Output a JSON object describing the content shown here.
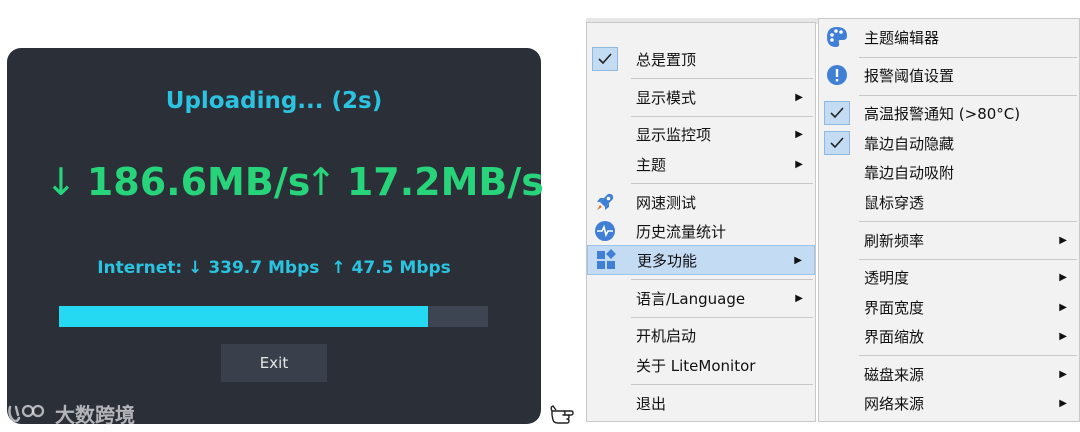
{
  "speed_test": {
    "status": "Uploading... (2s)",
    "download_arrow": "↓",
    "download_speed": "186.6MB/s",
    "upload_arrow": "↑",
    "upload_speed": "17.2MB/s",
    "internet_label": "Internet:",
    "internet_down": "↓ 339.7 Mbps",
    "internet_up": "↑ 47.5 Mbps",
    "progress_fraction": 0.86,
    "exit_label": "Exit"
  },
  "watermark": {
    "text": "大数跨境"
  },
  "main_menu": {
    "items": [
      {
        "label": "总是置顶",
        "checked": true
      },
      {
        "label": "显示模式",
        "submenu": true
      },
      {
        "label": "显示监控项",
        "submenu": true
      },
      {
        "label": "主题",
        "submenu": true
      },
      {
        "label": "网速测试",
        "icon": "rocket-icon"
      },
      {
        "label": "历史流量统计",
        "icon": "pulse-icon"
      },
      {
        "label": "更多功能",
        "icon": "apps-grid-icon",
        "submenu": true,
        "highlighted": true
      },
      {
        "label": "语言/Language",
        "submenu": true
      },
      {
        "label": "开机启动"
      },
      {
        "label": "关于 LiteMonitor"
      },
      {
        "label": "退出"
      }
    ]
  },
  "more_menu": {
    "items": [
      {
        "label": "主题编辑器",
        "icon": "palette-icon"
      },
      {
        "label": "报警阈值设置",
        "icon": "alert-icon"
      },
      {
        "label": "高温报警通知 (>80°C)",
        "checked": true
      },
      {
        "label": "靠边自动隐藏",
        "checked": true
      },
      {
        "label": "靠边自动吸附"
      },
      {
        "label": "鼠标穿透"
      },
      {
        "label": "刷新频率",
        "submenu": true
      },
      {
        "label": "透明度",
        "submenu": true
      },
      {
        "label": "界面宽度",
        "submenu": true
      },
      {
        "label": "界面缩放",
        "submenu": true
      },
      {
        "label": "磁盘来源",
        "submenu": true
      },
      {
        "label": "网络来源",
        "submenu": true
      }
    ]
  },
  "colors": {
    "dialog_bg": "#2a2f38",
    "accent_cyan": "#2bc3e0",
    "speed_green": "#27d47a",
    "progress_fill": "#26d9f2",
    "menu_highlight": "#c4dcf3"
  }
}
